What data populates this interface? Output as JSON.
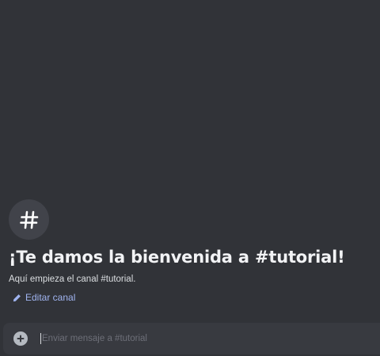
{
  "channel": {
    "icon": "hashtag-icon",
    "welcome_title": "¡Te damos la bienvenida a #tutorial!",
    "welcome_subtitle": "Aquí empieza el canal #tutorial.",
    "edit_label": "Editar canal"
  },
  "composer": {
    "add_icon": "plus-circle-icon",
    "placeholder": "Enviar mensaje a #tutorial",
    "value": ""
  },
  "colors": {
    "background": "#313338",
    "composer_background": "#383a40",
    "link": "#a0b4f0",
    "title": "#f2f3f5"
  }
}
